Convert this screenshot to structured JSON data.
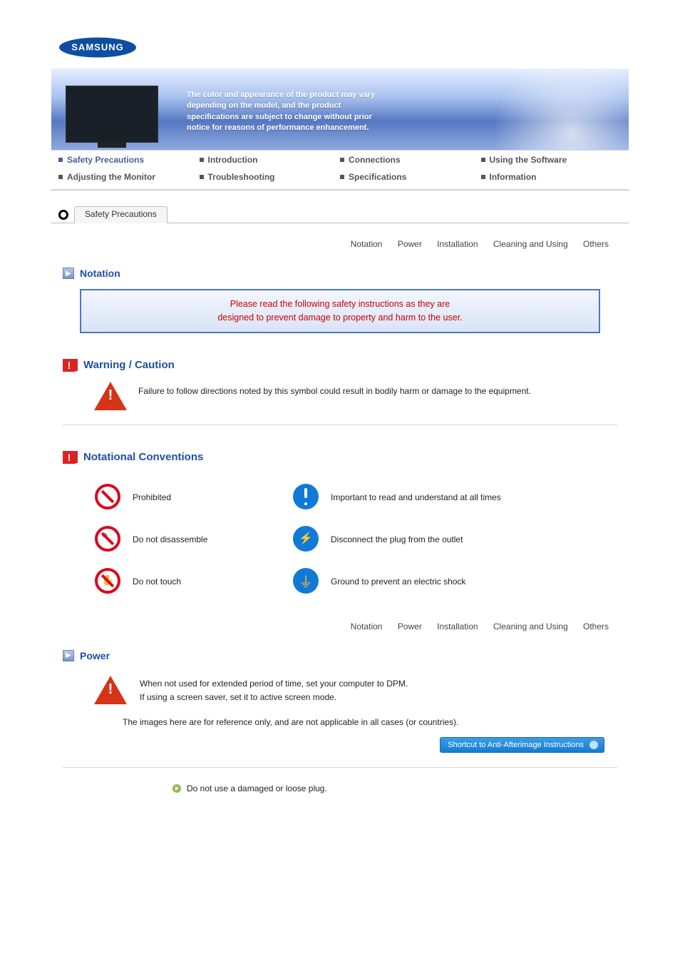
{
  "brand": "SAMSUNG",
  "banner": {
    "text_line1": "The color and appearance of the product may vary",
    "text_line2": "depending on the model, and the product",
    "text_line3": "specifications are subject to change without prior",
    "text_line4": "notice for reasons of performance enhancement."
  },
  "nav": {
    "row1": {
      "link1": "Safety Precautions",
      "link2": "Introduction",
      "link3": "Connections",
      "link4": "Using the Software"
    },
    "row2": {
      "link1": "Adjusting the Monitor",
      "link2": "Troubleshooting",
      "link3": "Specifications",
      "link4": "Information"
    }
  },
  "section_tab": "Safety Precautions",
  "subnav": {
    "item1": "Notation",
    "item2": "Power",
    "item3": "Installation",
    "item4": "Cleaning and Using",
    "item5": "Others"
  },
  "headings": {
    "notation": "Notation",
    "warning": "Warning / Caution",
    "notational_conventions": "Notational Conventions",
    "power": "Power"
  },
  "callout": {
    "line1": "Please read the following safety instructions as they are",
    "line2": "designed to prevent damage to property and harm to the user."
  },
  "warning_text": "Failure to follow directions noted by this symbol could result in bodily harm or damage to the equipment.",
  "conventions": {
    "prohibited": "Prohibited",
    "important": "Important to read and understand at all times",
    "disassemble": "Do not disassemble",
    "disconnect": "Disconnect the plug from the outlet",
    "no_touch": "Do not touch",
    "ground": "Ground to prevent an electric shock"
  },
  "power_section": {
    "line1": "When not used for extended period of time, set your computer to DPM.",
    "line2": "If using a screen saver, set it to active screen mode.",
    "note": "The images here are for reference only, and are not applicable in all cases (or countries).",
    "shortcut": "Shortcut to Anti-Afterimage Instructions",
    "bullet1": "Do not use a damaged or loose plug."
  }
}
